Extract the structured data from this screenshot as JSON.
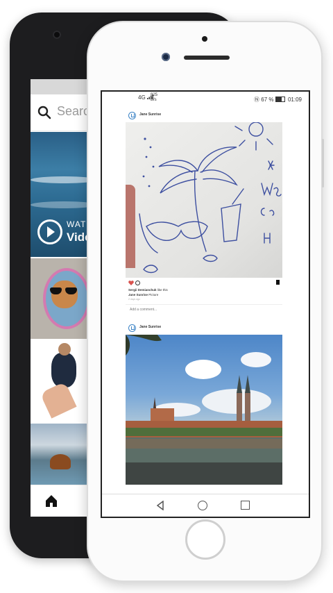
{
  "back_phone": {
    "search": {
      "placeholder": "Search",
      "icon": "search-icon"
    },
    "video_tile": {
      "watch_label": "WATCH",
      "video_label": "Video"
    },
    "nav": {
      "icon": "home-icon"
    }
  },
  "front_phone": {
    "status_bar": {
      "signal": "4G",
      "speed": "825",
      "speed_unit": "B/s",
      "battery": "67 %",
      "time": "01:09"
    },
    "posts": [
      {
        "username": "Jane Sunrise",
        "likes_user": "Sergii Demianchuk",
        "likes_suffix": "like this",
        "caption_user": "Jane Sunrise",
        "caption_text": "Picture",
        "timestamp": "2 days ago",
        "comment_placeholder": "Add a comment..."
      },
      {
        "username": "Jane Sunrise"
      }
    ],
    "nav": [
      "back-icon",
      "home-circle-icon",
      "recents-icon"
    ]
  },
  "colors": {
    "heart": "#d9534f",
    "accent": "#3d84c6"
  }
}
